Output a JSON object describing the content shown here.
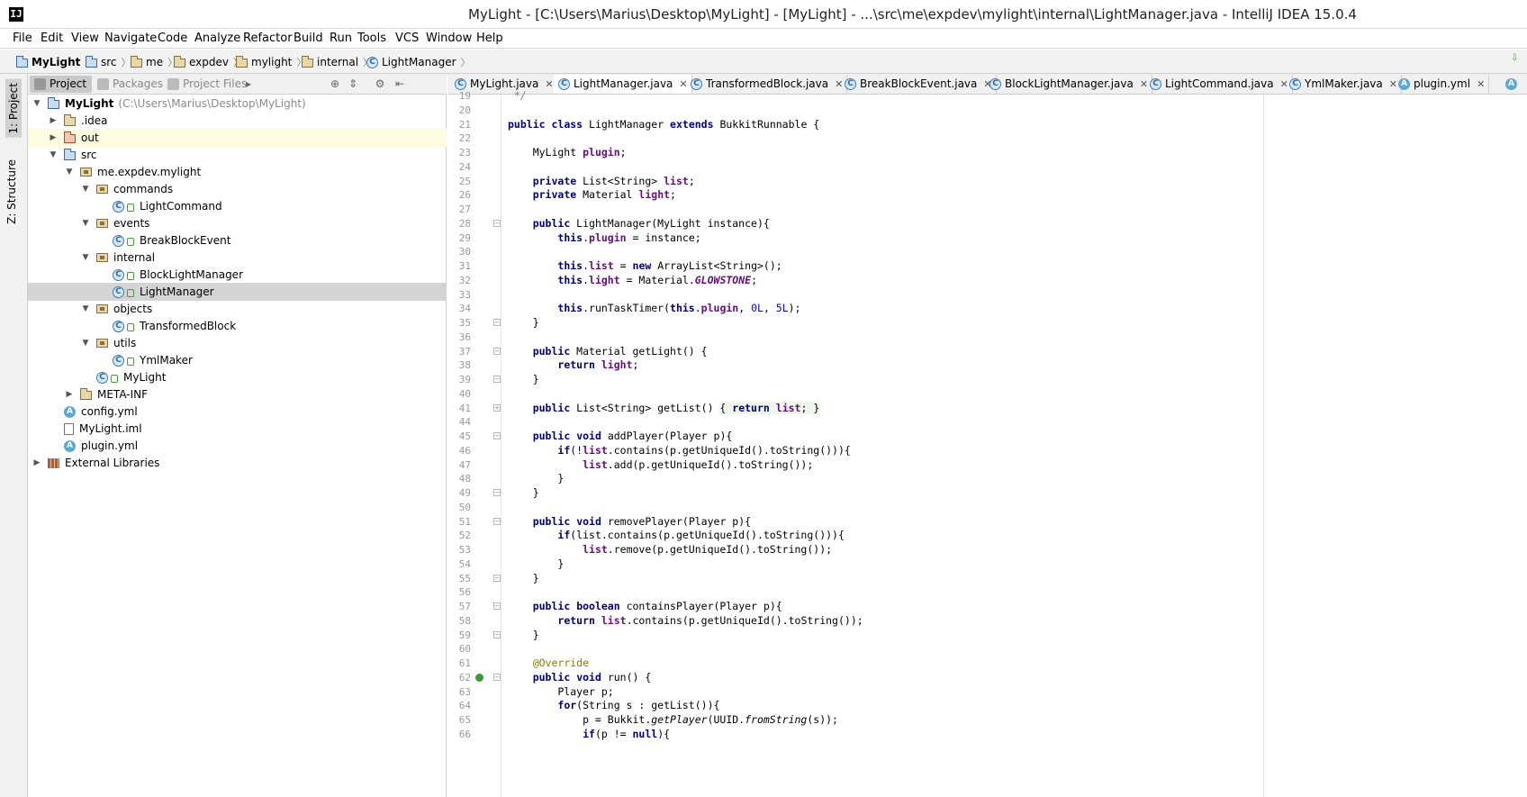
{
  "window": {
    "title": "MyLight - [C:\\Users\\Marius\\Desktop\\MyLight] - [MyLight] - ...\\src\\me\\expdev\\mylight\\internal\\LightManager.java - IntelliJ IDEA 15.0.4",
    "logo": "IJ"
  },
  "menu": [
    "File",
    "Edit",
    "View",
    "Navigate",
    "Code",
    "Analyze",
    "Refactor",
    "Build",
    "Run",
    "Tools",
    "VCS",
    "Window",
    "Help"
  ],
  "breadcrumbs": [
    "MyLight",
    "src",
    "me",
    "expdev",
    "mylight",
    "internal",
    "LightManager"
  ],
  "tool_windows": {
    "project": "1: Project",
    "structure": "Z: Structure"
  },
  "project_panel": {
    "tabs": [
      "Project",
      "Packages",
      "Project Files"
    ],
    "tree": [
      {
        "label": "MyLight",
        "extra": "(C:\\Users\\Marius\\Desktop\\MyLight)",
        "depth": 0,
        "arrow": "down",
        "icon": "module-folder-icon"
      },
      {
        "label": ".idea",
        "depth": 1,
        "arrow": "right",
        "icon": "folder-icon"
      },
      {
        "label": "out",
        "depth": 1,
        "arrow": "right",
        "icon": "excluded-folder-icon"
      },
      {
        "label": "src",
        "depth": 1,
        "arrow": "down",
        "icon": "source-folder-icon"
      },
      {
        "label": "me.expdev.mylight",
        "depth": 2,
        "arrow": "down",
        "icon": "package-icon"
      },
      {
        "label": "commands",
        "depth": 3,
        "arrow": "down",
        "icon": "package-icon"
      },
      {
        "label": "LightCommand",
        "depth": 4,
        "arrow": "",
        "icon": "class-icon"
      },
      {
        "label": "events",
        "depth": 3,
        "arrow": "down",
        "icon": "package-icon"
      },
      {
        "label": "BreakBlockEvent",
        "depth": 4,
        "arrow": "",
        "icon": "class-icon"
      },
      {
        "label": "internal",
        "depth": 3,
        "arrow": "down",
        "icon": "package-icon"
      },
      {
        "label": "BlockLightManager",
        "depth": 4,
        "arrow": "",
        "icon": "class-icon"
      },
      {
        "label": "LightManager",
        "depth": 4,
        "arrow": "",
        "icon": "class-icon"
      },
      {
        "label": "objects",
        "depth": 3,
        "arrow": "down",
        "icon": "package-icon"
      },
      {
        "label": "TransformedBlock",
        "depth": 4,
        "arrow": "",
        "icon": "class-icon"
      },
      {
        "label": "utils",
        "depth": 3,
        "arrow": "down",
        "icon": "package-icon"
      },
      {
        "label": "YmlMaker",
        "depth": 4,
        "arrow": "",
        "icon": "class-icon"
      },
      {
        "label": "MyLight",
        "depth": 3,
        "arrow": "",
        "icon": "class-icon"
      },
      {
        "label": "META-INF",
        "depth": 2,
        "arrow": "right",
        "icon": "folder-icon"
      },
      {
        "label": "config.yml",
        "depth": 1,
        "arrow": "",
        "icon": "yaml-icon"
      },
      {
        "label": "MyLight.iml",
        "depth": 1,
        "arrow": "",
        "icon": "file-icon"
      },
      {
        "label": "plugin.yml",
        "depth": 1,
        "arrow": "",
        "icon": "yaml-icon"
      },
      {
        "label": "External Libraries",
        "depth": 0,
        "arrow": "right",
        "icon": "library-icon"
      }
    ]
  },
  "editor_tabs": [
    {
      "label": "MyLight.java",
      "icon": "class-icon",
      "active": false
    },
    {
      "label": "LightManager.java",
      "icon": "class-icon",
      "active": true
    },
    {
      "label": "TransformedBlock.java",
      "icon": "class-icon",
      "active": false
    },
    {
      "label": "BreakBlockEvent.java",
      "icon": "class-icon",
      "active": false
    },
    {
      "label": "BlockLightManager.java",
      "icon": "class-icon",
      "active": false
    },
    {
      "label": "LightCommand.java",
      "icon": "class-icon",
      "active": false
    },
    {
      "label": "YmlMaker.java",
      "icon": "class-icon",
      "active": false
    },
    {
      "label": "plugin.yml",
      "icon": "yaml-icon",
      "active": false
    }
  ],
  "code": [
    {
      "n": "19",
      "t": " */"
    },
    {
      "n": "20",
      "t": ""
    },
    {
      "n": "21",
      "t": "public class LightManager extends BukkitRunnable {"
    },
    {
      "n": "22",
      "t": ""
    },
    {
      "n": "23",
      "t": "    MyLight plugin;"
    },
    {
      "n": "24",
      "t": ""
    },
    {
      "n": "25",
      "t": "    private List<String> list;"
    },
    {
      "n": "26",
      "t": "    private Material light;"
    },
    {
      "n": "27",
      "t": ""
    },
    {
      "n": "28",
      "t": "    public LightManager(MyLight instance){"
    },
    {
      "n": "29",
      "t": "        this.plugin = instance;"
    },
    {
      "n": "30",
      "t": ""
    },
    {
      "n": "31",
      "t": "        this.list = new ArrayList<String>();"
    },
    {
      "n": "32",
      "t": "        this.light = Material.GLOWSTONE;"
    },
    {
      "n": "33",
      "t": ""
    },
    {
      "n": "34",
      "t": "        this.runTaskTimer(this.plugin, 0L, 5L);"
    },
    {
      "n": "35",
      "t": "    }"
    },
    {
      "n": "36",
      "t": ""
    },
    {
      "n": "37",
      "t": "    public Material getLight() {"
    },
    {
      "n": "38",
      "t": "        return light;"
    },
    {
      "n": "39",
      "t": "    }"
    },
    {
      "n": "40",
      "t": ""
    },
    {
      "n": "41",
      "t": "    public List<String> getList() { return list; }"
    },
    {
      "n": "44",
      "t": ""
    },
    {
      "n": "45",
      "t": "    public void addPlayer(Player p){"
    },
    {
      "n": "46",
      "t": "        if(!list.contains(p.getUniqueId().toString())){"
    },
    {
      "n": "47",
      "t": "            list.add(p.getUniqueId().toString());"
    },
    {
      "n": "48",
      "t": "        }"
    },
    {
      "n": "49",
      "t": "    }"
    },
    {
      "n": "50",
      "t": ""
    },
    {
      "n": "51",
      "t": "    public void removePlayer(Player p){"
    },
    {
      "n": "52",
      "t": "        if(list.contains(p.getUniqueId().toString())){"
    },
    {
      "n": "53",
      "t": "            list.remove(p.getUniqueId().toString());"
    },
    {
      "n": "54",
      "t": "        }"
    },
    {
      "n": "55",
      "t": "    }"
    },
    {
      "n": "56",
      "t": ""
    },
    {
      "n": "57",
      "t": "    public boolean containsPlayer(Player p){"
    },
    {
      "n": "58",
      "t": "        return list.contains(p.getUniqueId().toString());"
    },
    {
      "n": "59",
      "t": "    }"
    },
    {
      "n": "60",
      "t": ""
    },
    {
      "n": "61",
      "t": "    @Override"
    },
    {
      "n": "62",
      "t": "    public void run() {"
    },
    {
      "n": "63",
      "t": "        Player p;"
    },
    {
      "n": "64",
      "t": "        for(String s : getList()){"
    },
    {
      "n": "65",
      "t": "            p = Bukkit.getPlayer(UUID.fromString(s));"
    },
    {
      "n": "66",
      "t": "            if(p != null){"
    }
  ]
}
